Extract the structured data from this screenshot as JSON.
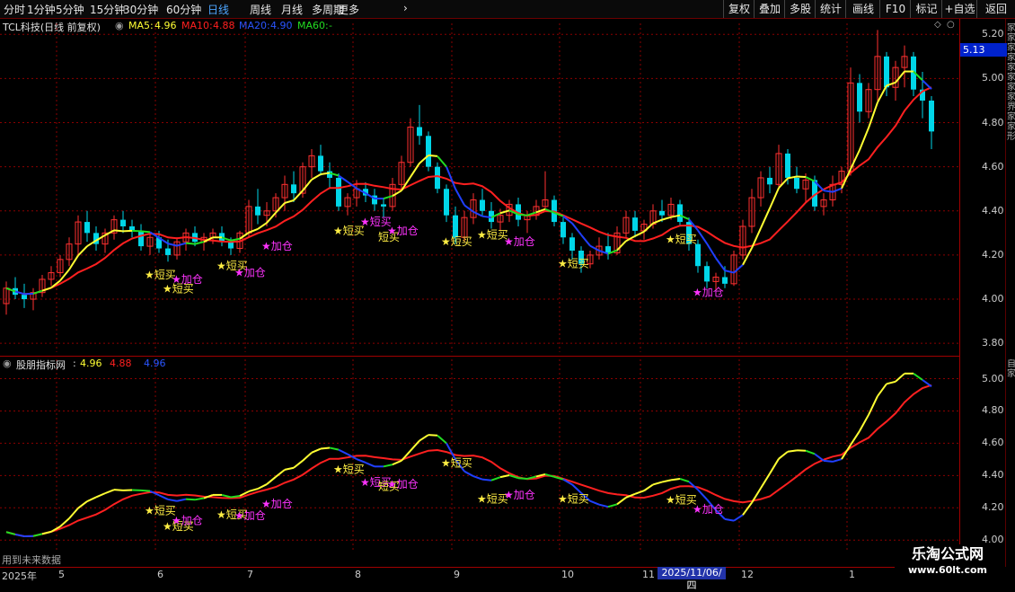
{
  "periods": [
    "分时",
    "1分钟",
    "5分钟",
    "15分钟",
    "30分钟",
    "60分钟",
    "日线",
    "周线",
    "月线",
    "多周期",
    "更多"
  ],
  "active_period": "日线",
  "more_chevron": "›",
  "right_tools": [
    "复权",
    "叠加",
    "多股",
    "统计",
    "画线",
    "F10",
    "标记",
    "+自选",
    "返回"
  ],
  "main_header": {
    "title": "TCL科技(日线 前复权)",
    "ma5_label": "MA5:",
    "ma5_value": "4.96",
    "ma10_label": "MA10:",
    "ma10_value": "4.88",
    "ma20_label": "MA20:",
    "ma20_value": "4.90",
    "ma60_label": "MA60:",
    "ma60_value": "-"
  },
  "sub_header": {
    "title": "股朋指标网",
    "colon": ":",
    "v1": "4.96",
    "v2": "4.88",
    "v3": "4.96"
  },
  "current_price": "5.13",
  "main_yaxis": [
    "5.20",
    "5.00",
    "4.80",
    "4.60",
    "4.40",
    "4.20",
    "4.00",
    "3.80"
  ],
  "sub_yaxis": [
    "5.00",
    "4.80",
    "4.60",
    "4.40",
    "4.20",
    "4.00"
  ],
  "future_data_text": "用到未来数据",
  "xaxis_labels": [
    {
      "t": "2025年",
      "day": 0
    },
    {
      "t": "5",
      "day": 6
    },
    {
      "t": "6",
      "day": 17
    },
    {
      "t": "7",
      "day": 27
    },
    {
      "t": "8",
      "day": 39
    },
    {
      "t": "9",
      "day": 50
    },
    {
      "t": "10",
      "day": 62
    },
    {
      "t": "11",
      "day": 71
    },
    {
      "t": "12",
      "day": 82
    },
    {
      "t": "1",
      "day": 94
    }
  ],
  "crosshair_date": "2025/11/06/四",
  "watermark": {
    "title": "乐淘公式网",
    "url": "www.60lt.com"
  },
  "right_strip_top": "家家家家家家家家界家家形",
  "right_strip_bottom": "自家",
  "colors": {
    "bg": "#000000",
    "grid": "#8b0000",
    "up": "#ff3030",
    "down": "#00d6e8",
    "ma_yellow": "#ffff33",
    "ma_red": "#ff2020",
    "ma_blue": "#2040ff",
    "ma_green": "#22dd22",
    "signal_buy": "#ffee44",
    "signal_add": "#ff33ff"
  },
  "chart_data": {
    "type": "candlestick",
    "symbol": "TCL科技",
    "period": "日线",
    "main_ylim": [
      3.76,
      5.25
    ],
    "sub_ylim": [
      3.94,
      5.12
    ],
    "ohlc": [
      [
        3.98,
        4.08,
        3.93,
        4.05
      ],
      [
        4.05,
        4.1,
        4.0,
        4.02
      ],
      [
        4.02,
        4.07,
        3.96,
        4.0
      ],
      [
        4.0,
        4.05,
        3.95,
        4.03
      ],
      [
        4.03,
        4.11,
        4.01,
        4.09
      ],
      [
        4.09,
        4.15,
        4.06,
        4.12
      ],
      [
        4.12,
        4.2,
        4.1,
        4.18
      ],
      [
        4.18,
        4.28,
        4.15,
        4.25
      ],
      [
        4.25,
        4.38,
        4.2,
        4.35
      ],
      [
        4.35,
        4.4,
        4.26,
        4.3
      ],
      [
        4.3,
        4.33,
        4.22,
        4.25
      ],
      [
        4.25,
        4.32,
        4.21,
        4.3
      ],
      [
        4.3,
        4.38,
        4.27,
        4.36
      ],
      [
        4.36,
        4.4,
        4.3,
        4.33
      ],
      [
        4.33,
        4.36,
        4.28,
        4.31
      ],
      [
        4.31,
        4.34,
        4.22,
        4.24
      ],
      [
        4.24,
        4.3,
        4.2,
        4.28
      ],
      [
        4.28,
        4.31,
        4.21,
        4.23
      ],
      [
        4.23,
        4.27,
        4.17,
        4.2
      ],
      [
        4.2,
        4.28,
        4.18,
        4.26
      ],
      [
        4.26,
        4.32,
        4.22,
        4.3
      ],
      [
        4.3,
        4.33,
        4.24,
        4.26
      ],
      [
        4.26,
        4.3,
        4.22,
        4.28
      ],
      [
        4.28,
        4.32,
        4.25,
        4.3
      ],
      [
        4.3,
        4.33,
        4.24,
        4.26
      ],
      [
        4.26,
        4.28,
        4.2,
        4.23
      ],
      [
        4.23,
        4.31,
        4.21,
        4.3
      ],
      [
        4.3,
        4.45,
        4.28,
        4.42
      ],
      [
        4.42,
        4.5,
        4.34,
        4.38
      ],
      [
        4.38,
        4.44,
        4.33,
        4.4
      ],
      [
        4.4,
        4.48,
        4.37,
        4.46
      ],
      [
        4.46,
        4.56,
        4.4,
        4.52
      ],
      [
        4.52,
        4.58,
        4.44,
        4.48
      ],
      [
        4.48,
        4.62,
        4.46,
        4.6
      ],
      [
        4.6,
        4.68,
        4.55,
        4.65
      ],
      [
        4.65,
        4.7,
        4.56,
        4.58
      ],
      [
        4.58,
        4.62,
        4.5,
        4.55
      ],
      [
        4.55,
        4.57,
        4.4,
        4.42
      ],
      [
        4.42,
        4.48,
        4.38,
        4.46
      ],
      [
        4.46,
        4.54,
        4.42,
        4.5
      ],
      [
        4.5,
        4.53,
        4.44,
        4.47
      ],
      [
        4.47,
        4.5,
        4.4,
        4.43
      ],
      [
        4.43,
        4.46,
        4.37,
        4.42
      ],
      [
        4.42,
        4.55,
        4.4,
        4.52
      ],
      [
        4.52,
        4.65,
        4.5,
        4.62
      ],
      [
        4.62,
        4.82,
        4.6,
        4.78
      ],
      [
        4.78,
        4.88,
        4.7,
        4.74
      ],
      [
        4.74,
        4.76,
        4.58,
        4.6
      ],
      [
        4.6,
        4.62,
        4.48,
        4.5
      ],
      [
        4.5,
        4.52,
        4.35,
        4.38
      ],
      [
        4.38,
        4.42,
        4.25,
        4.28
      ],
      [
        4.28,
        4.4,
        4.26,
        4.37
      ],
      [
        4.37,
        4.48,
        4.34,
        4.45
      ],
      [
        4.45,
        4.5,
        4.38,
        4.4
      ],
      [
        4.4,
        4.44,
        4.32,
        4.35
      ],
      [
        4.35,
        4.41,
        4.31,
        4.38
      ],
      [
        4.38,
        4.45,
        4.35,
        4.43
      ],
      [
        4.43,
        4.46,
        4.33,
        4.36
      ],
      [
        4.36,
        4.4,
        4.3,
        4.38
      ],
      [
        4.38,
        4.45,
        4.36,
        4.42
      ],
      [
        4.42,
        4.58,
        4.4,
        4.45
      ],
      [
        4.45,
        4.47,
        4.33,
        4.35
      ],
      [
        4.35,
        4.37,
        4.25,
        4.28
      ],
      [
        4.28,
        4.3,
        4.18,
        4.22
      ],
      [
        4.22,
        4.24,
        4.12,
        4.16
      ],
      [
        4.16,
        4.22,
        4.14,
        4.2
      ],
      [
        4.2,
        4.28,
        4.18,
        4.24
      ],
      [
        4.24,
        4.3,
        4.18,
        4.21
      ],
      [
        4.21,
        4.33,
        4.2,
        4.3
      ],
      [
        4.3,
        4.4,
        4.28,
        4.37
      ],
      [
        4.37,
        4.4,
        4.28,
        4.31
      ],
      [
        4.31,
        4.36,
        4.27,
        4.34
      ],
      [
        4.34,
        4.43,
        4.32,
        4.4
      ],
      [
        4.4,
        4.45,
        4.35,
        4.38
      ],
      [
        4.38,
        4.46,
        4.36,
        4.43
      ],
      [
        4.43,
        4.45,
        4.33,
        4.35
      ],
      [
        4.35,
        4.37,
        4.22,
        4.25
      ],
      [
        4.25,
        4.27,
        4.12,
        4.15
      ],
      [
        4.15,
        4.17,
        4.05,
        4.08
      ],
      [
        4.08,
        4.12,
        4.04,
        4.1
      ],
      [
        4.1,
        4.15,
        4.05,
        4.07
      ],
      [
        4.07,
        4.22,
        4.06,
        4.2
      ],
      [
        4.2,
        4.36,
        4.18,
        4.33
      ],
      [
        4.33,
        4.5,
        4.3,
        4.46
      ],
      [
        4.46,
        4.58,
        4.42,
        4.55
      ],
      [
        4.55,
        4.6,
        4.48,
        4.52
      ],
      [
        4.52,
        4.7,
        4.5,
        4.66
      ],
      [
        4.66,
        4.68,
        4.52,
        4.55
      ],
      [
        4.55,
        4.6,
        4.48,
        4.5
      ],
      [
        4.5,
        4.57,
        4.44,
        4.54
      ],
      [
        4.54,
        4.56,
        4.4,
        4.42
      ],
      [
        4.42,
        4.48,
        4.38,
        4.45
      ],
      [
        4.45,
        4.56,
        4.42,
        4.52
      ],
      [
        4.52,
        4.6,
        4.48,
        4.58
      ],
      [
        4.58,
        5.05,
        4.56,
        4.98
      ],
      [
        4.98,
        5.02,
        4.8,
        4.85
      ],
      [
        4.85,
        4.98,
        4.82,
        4.95
      ],
      [
        4.95,
        5.22,
        4.9,
        5.1
      ],
      [
        5.1,
        5.12,
        4.92,
        4.96
      ],
      [
        4.96,
        5.08,
        4.9,
        5.05
      ],
      [
        5.05,
        5.15,
        4.96,
        5.1
      ],
      [
        5.1,
        5.12,
        4.92,
        4.95
      ],
      [
        4.95,
        5.03,
        4.82,
        4.9
      ],
      [
        4.9,
        4.92,
        4.68,
        4.76
      ]
    ],
    "signals": [
      {
        "day": 16,
        "type": "buy",
        "text": "★短买",
        "offset": 0
      },
      {
        "day": 18,
        "type": "buy",
        "text": "★短买",
        "offset": 1
      },
      {
        "day": 19,
        "type": "add",
        "text": "★加仓",
        "offset": 0
      },
      {
        "day": 24,
        "type": "buy",
        "text": "★短买",
        "offset": 0
      },
      {
        "day": 26,
        "type": "add",
        "text": "★加仓",
        "offset": 0
      },
      {
        "day": 29,
        "type": "add",
        "text": "★加仓",
        "offset": 0
      },
      {
        "day": 37,
        "type": "buy",
        "text": "★短买",
        "offset": 0
      },
      {
        "day": 40,
        "type": "add",
        "text": "★短买",
        "offset": 0
      },
      {
        "day": 42,
        "type": "buy",
        "text": "短买",
        "offset": 0
      },
      {
        "day": 43,
        "type": "add",
        "text": "★加仓",
        "offset": 0
      },
      {
        "day": 49,
        "type": "buy",
        "text": "★短买",
        "offset": 0
      },
      {
        "day": 53,
        "type": "buy",
        "text": "★短买",
        "offset": 0
      },
      {
        "day": 56,
        "type": "add",
        "text": "★加仓",
        "offset": 0
      },
      {
        "day": 62,
        "type": "buy",
        "text": "★短买",
        "offset": 0
      },
      {
        "day": 74,
        "type": "buy",
        "text": "★短买",
        "offset": 0
      },
      {
        "day": 77,
        "type": "add",
        "text": "★加仓",
        "offset": 0
      }
    ]
  }
}
